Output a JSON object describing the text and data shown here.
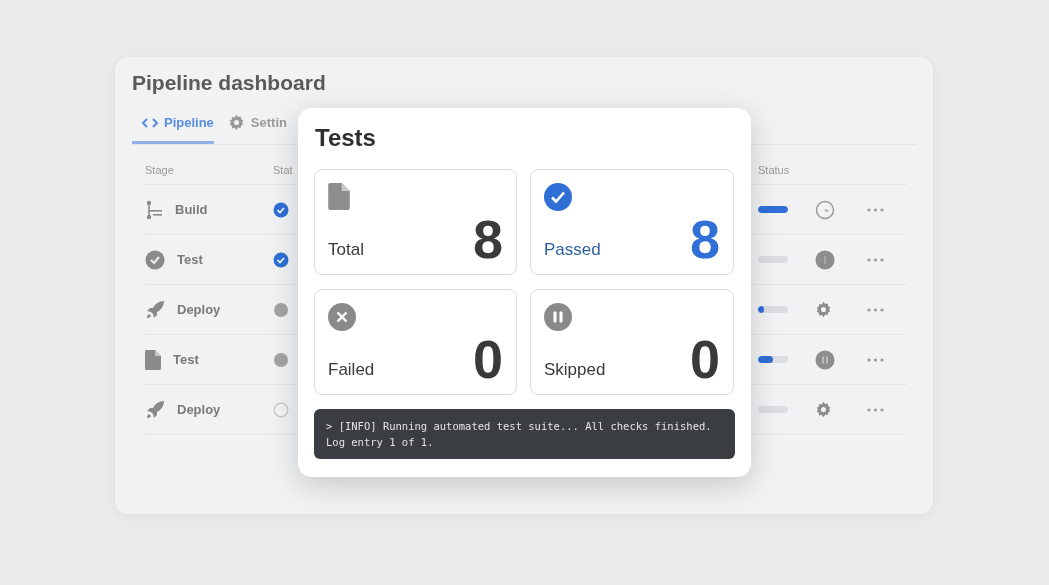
{
  "dashboard": {
    "title": "Pipeline dashboard",
    "tabs": [
      {
        "label": "Pipeline",
        "selected": true
      },
      {
        "label": "Settin",
        "selected": false
      }
    ],
    "columns": [
      "Stage",
      "Stat",
      "Status"
    ],
    "rows": [
      {
        "stage": "Build",
        "kind": "done",
        "level": 1
      },
      {
        "stage": "Test",
        "kind": "done",
        "level": 0
      },
      {
        "stage": "Deploy",
        "kind": "pending",
        "level": 0.2
      },
      {
        "stage": "Test",
        "kind": "pending",
        "level": 0.5
      },
      {
        "stage": "Deploy",
        "kind": "none",
        "level": 0
      }
    ]
  },
  "dialog": {
    "title": "Tests",
    "cards": [
      {
        "kind": "total",
        "label": "Total",
        "value": "8"
      },
      {
        "kind": "passed",
        "label": "Passed",
        "value": "8"
      },
      {
        "kind": "failed",
        "label": "Failed",
        "value": "0"
      },
      {
        "kind": "skipped",
        "label": "Skipped",
        "value": "0"
      }
    ],
    "log": "> [INFO] Running automated test suite... All checks finished.\nLog entry 1 of 1."
  }
}
